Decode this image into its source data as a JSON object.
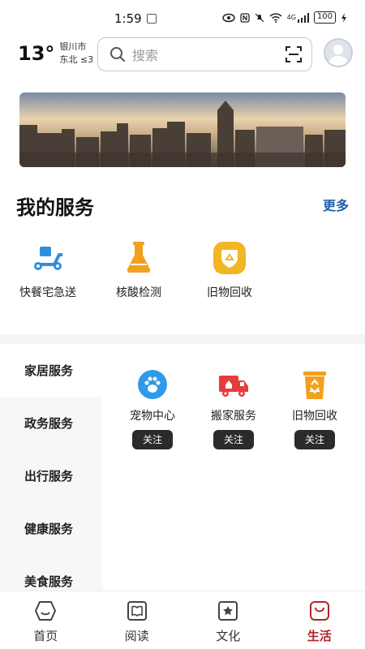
{
  "status_bar": {
    "time": "1:59",
    "network_label": "4G",
    "battery": "100"
  },
  "header": {
    "temperature": "13°",
    "city": "银川市",
    "wind": "东北 ≤3",
    "search_placeholder": "搜索"
  },
  "my_services": {
    "title": "我的服务",
    "more_label": "更多",
    "items": [
      {
        "label": "快餐宅急送",
        "icon": "delivery-scooter-icon"
      },
      {
        "label": "核酸检测",
        "icon": "flask-icon"
      },
      {
        "label": "旧物回收",
        "icon": "recycle-badge-icon"
      }
    ]
  },
  "categories": {
    "items": [
      {
        "label": "家居服务",
        "active": true
      },
      {
        "label": "政务服务",
        "active": false
      },
      {
        "label": "出行服务",
        "active": false
      },
      {
        "label": "健康服务",
        "active": false
      },
      {
        "label": "美食服务",
        "active": false
      }
    ],
    "services": [
      {
        "label": "宠物中心",
        "icon": "paw-icon",
        "button": "关注"
      },
      {
        "label": "搬家服务",
        "icon": "moving-truck-icon",
        "button": "关注"
      },
      {
        "label": "旧物回收",
        "icon": "recycle-bin-icon",
        "button": "关注"
      }
    ]
  },
  "bottom_nav": {
    "items": [
      {
        "label": "首页",
        "icon": "home-icon",
        "active": false
      },
      {
        "label": "阅读",
        "icon": "book-icon",
        "active": false
      },
      {
        "label": "文化",
        "icon": "star-square-icon",
        "active": false
      },
      {
        "label": "生活",
        "icon": "shopping-bag-icon",
        "active": true
      }
    ]
  },
  "colors": {
    "accent_link": "#1f5fa8",
    "active_nav": "#b0242a",
    "service_blue": "#2f8fe0",
    "service_orange": "#f2a11c",
    "follow_button": "#2b2b2b"
  }
}
